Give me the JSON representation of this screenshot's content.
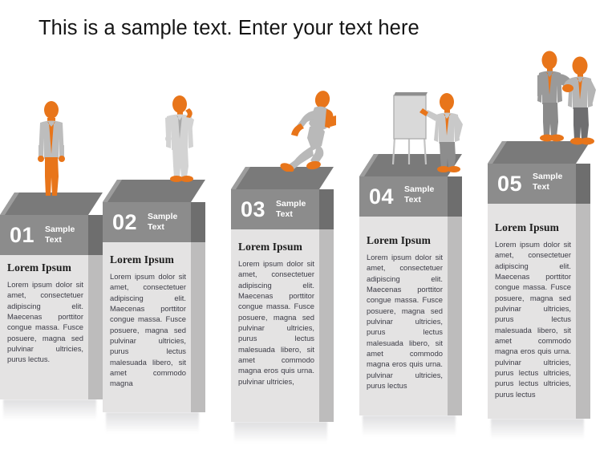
{
  "slide": {
    "title": "This is a sample text. Enter your text here",
    "background_color": "#ffffff"
  },
  "theme": {
    "accent_orange": "#e8751a",
    "gray_light": "#bdbdbd",
    "gray_mid": "#8c8c8c",
    "gray_dark": "#6e6e6e",
    "body_fill": "#e4e3e3",
    "text_color": "#3c3c46",
    "heading_color": "#1c1c1c",
    "number_color": "#ffffff"
  },
  "steps": [
    {
      "number": "01",
      "sample_label": "Sample Text",
      "heading": "Lorem Ipsum",
      "paragraph": "Lorem ipsum dolor sit amet, consectetuer adipiscing elit. Maecenas porttitor congue massa. Fusce posuere, magna sed pulvinar ultricies, purus lectus.",
      "figure": "businessman-walking"
    },
    {
      "number": "02",
      "sample_label": "Sample Text",
      "heading": "Lorem Ipsum",
      "paragraph": "Lorem ipsum dolor sit amet, consectetuer adipiscing elit. Maecenas porttitor congue massa. Fusce posuere, magna sed pulvinar ultricies, purus lectus malesuada libero, sit amet commodo magna",
      "figure": "businessman-on-phone"
    },
    {
      "number": "03",
      "sample_label": "Sample Text",
      "heading": "Lorem Ipsum",
      "paragraph": "Lorem ipsum dolor sit amet, consectetuer adipiscing elit. Maecenas porttitor congue massa. Fusce posuere, magna sed pulvinar ultricies, purus lectus malesuada libero, sit amet commodo magna eros quis urna. pulvinar ultricies,",
      "figure": "running-man"
    },
    {
      "number": "04",
      "sample_label": "Sample Text",
      "heading": "Lorem Ipsum",
      "paragraph": "Lorem ipsum dolor sit amet, consectetuer adipiscing elit. Maecenas porttitor congue massa. Fusce posuere, magna sed pulvinar ultricies, purus lectus malesuada libero, sit amet commodo magna eros quis urna. pulvinar ultricies, purus lectus",
      "figure": "presenter-at-flipchart"
    },
    {
      "number": "05",
      "sample_label": "Sample Text",
      "heading": "Lorem Ipsum",
      "paragraph": "Lorem ipsum dolor sit amet, consectetuer adipiscing elit. Maecenas porttitor congue massa. Fusce posuere, magna sed pulvinar ultricies, purus lectus malesuada libero, sit amet commodo magna eros quis urna. pulvinar ultricies, purus lectus ultricies, purus lectus ultricies, purus lectus",
      "figure": "handshake-two-businessmen"
    }
  ]
}
